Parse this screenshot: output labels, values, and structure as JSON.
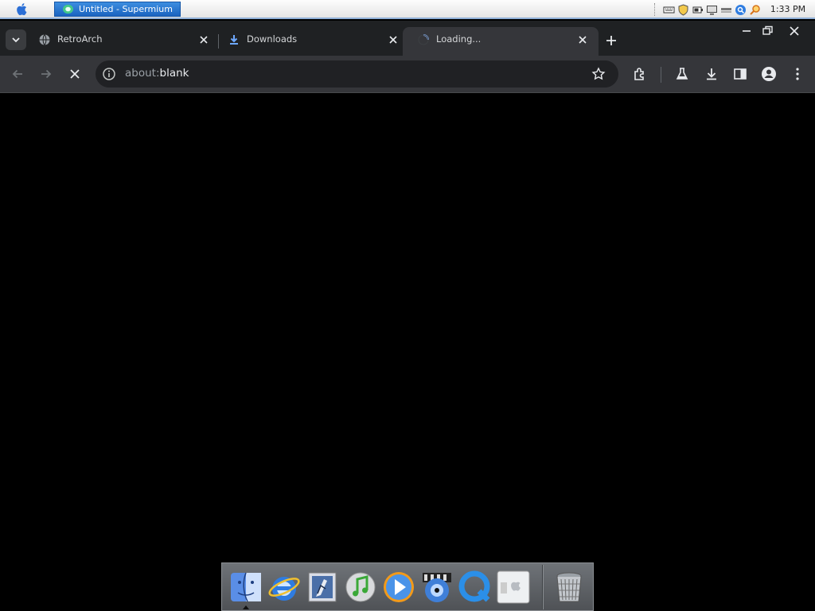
{
  "system_bar": {
    "apple_menu": "apple-logo-icon",
    "active_window_title": "Untitled - Supermium",
    "tray_icons": [
      "keyboard-icon",
      "shield-icon",
      "battery-icon",
      "monitor-icon",
      "network-icon",
      "search-icon",
      "magnifier-icon"
    ],
    "clock": "1:33 PM"
  },
  "browser": {
    "tabs": [
      {
        "title": "RetroArch",
        "icon": "globe-icon",
        "active": false
      },
      {
        "title": "Downloads",
        "icon": "download-icon",
        "active": false
      },
      {
        "title": "Loading...",
        "icon": "spinner-icon",
        "active": true
      }
    ],
    "new_tab_label": "+",
    "toolbar": {
      "back": "back-arrow-icon",
      "forward": "forward-arrow-icon",
      "stop": "stop-icon",
      "url_scheme": "about:",
      "url_rest": "blank",
      "right_icons": [
        "extensions-icon",
        "labs-icon",
        "downloads-icon",
        "side-panel-icon",
        "profile-icon",
        "menu-icon"
      ]
    },
    "page_background": "#000000"
  },
  "dock": {
    "apps": [
      "finder-icon",
      "internet-explorer-icon",
      "mail-icon",
      "itunes-icon",
      "media-player-icon",
      "dvd-player-icon",
      "quicktime-icon",
      "bootcamp-icon"
    ],
    "trash": "trash-icon"
  },
  "colors": {
    "tab_strip": "#1f2123",
    "toolbar": "#35363a",
    "omnibox": "#202124",
    "active_task": "#2a76d2"
  }
}
